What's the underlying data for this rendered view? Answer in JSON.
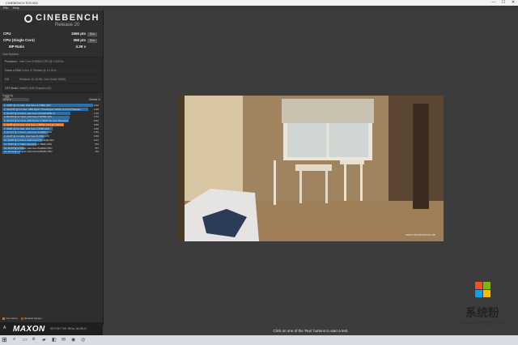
{
  "window": {
    "title": "CINEBENCH R20.060",
    "minimize": "—",
    "maximize": "☐",
    "close": "✕"
  },
  "menu": {
    "file": "File",
    "help": "Help"
  },
  "logo": {
    "name": "CINEBENCH",
    "release": "Release 20"
  },
  "scores": [
    {
      "label": "CPU",
      "value": "1565 pts",
      "run": "Run"
    },
    {
      "label": "CPU (Single Core)",
      "value": "356 pts",
      "run": "Run"
    },
    {
      "label": "MP Ratio",
      "value": "4.39 x"
    }
  ],
  "sysinfo": {
    "header": "Your System",
    "rows": [
      {
        "key": "Processor",
        "value": "Intel Core i5-8250U CPU @ 1.60GHz"
      },
      {
        "key": "Cores x GHz",
        "value": "4 Cores, 8 Threads @ 3.4 GHz"
      },
      {
        "key": "OS",
        "value": "Windows 10, 64 Bit, Core (build 18362)"
      },
      {
        "key": "GFX Board",
        "value": "Intel(R) UHD Graphics 620"
      },
      {
        "key": "Info",
        "value": ""
      }
    ]
  },
  "ranking": {
    "header": "Ranking",
    "dropdown": "CPU",
    "details": "Details",
    "rows": [
      {
        "label": "1. 4C/8T @ 3.3 GHz, Intel Core i7-7700K CPU",
        "score": "2318",
        "fraction": 1.0,
        "mine": false
      },
      {
        "label": "2. 12C/24T @ 3.4 GHz, AMD Ryzen Threadripper 1920X 12-Core Processor",
        "score": "2193",
        "fraction": 0.946,
        "mine": false
      },
      {
        "label": "3. 8C/16T @ 3.0 GHz, Intel Xeon CPU E5-2650 v2",
        "score": "1745",
        "fraction": 0.753,
        "mine": false
      },
      {
        "label": "4. 8C/16T @ 3.7 GHz, Intel Core i7-9700K CPU",
        "score": "1710",
        "fraction": 0.738,
        "mine": false
      },
      {
        "label": "5. 6C/12T @ 3.6 GHz, AMD Ryzen 5 2600X Six-Core Processor",
        "score": "1691",
        "fraction": 0.729,
        "mine": false
      },
      {
        "label": "6. 4C/8T @ 2.9 GHz, Intel Core i7-8565U CPU @ 1.80GHz",
        "score": "1565",
        "fraction": 0.675,
        "mine": true
      },
      {
        "label": "7. 4C/8T @ 3.1 GHz, Intel Core i7-6700 CPU",
        "score": "1282",
        "fraction": 0.553,
        "mine": false
      },
      {
        "label": "8. 6C/12T @ 2.9 GHz, Intel Core i5-9400F CPU",
        "score": "1154",
        "fraction": 0.498,
        "mine": false
      },
      {
        "label": "9. 4C/4T @ 3.4 GHz, Intel Core i5-7600 CPU",
        "score": "1083",
        "fraction": 0.467,
        "mine": false
      },
      {
        "label": "10. 4C/8T @ 2.6 GHz, Intel Core i7-6700HQ CPU",
        "score": "1021",
        "fraction": 0.44,
        "mine": false
      },
      {
        "label": "11. 4C/8T @ 2.7 GHz, Intel Core i7-7500U CPU",
        "score": "873",
        "fraction": 0.377,
        "mine": false
      },
      {
        "label": "12. 2C/4T @ 2.3 GHz, Intel Core i5-6200U CPU",
        "score": "557",
        "fraction": 0.24,
        "mine": false
      },
      {
        "label": "13. 2C/4T @ 1.8 GHz, Intel Core i3-8130U CPU",
        "score": "452",
        "fraction": 0.195,
        "mine": false
      }
    ]
  },
  "legend": {
    "your_score": "Your Score",
    "identical": "Identical System"
  },
  "branding": {
    "maxon": "MAXON",
    "sub": "A",
    "tagline": "3D FOR THE REAL WORLD"
  },
  "render": {
    "watermark": "www.renderbaron.de"
  },
  "status": "Click on one of the 'Run' buttons to start a test.",
  "taskbar": {
    "start": "⊞",
    "search": "⌕"
  },
  "watermark": {
    "text": "系统粉",
    "url": "www.win7999.com"
  },
  "colors": {
    "accent": "#2a6fa8",
    "highlight": "#d2691e"
  }
}
